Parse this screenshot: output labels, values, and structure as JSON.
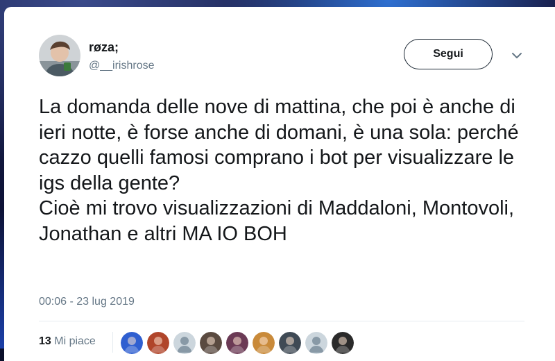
{
  "user": {
    "display_name": "røza;",
    "handle": "@__irishrose"
  },
  "follow_button": {
    "label": "Segui"
  },
  "menu": {
    "icon": "chevron-down-icon"
  },
  "tweet": {
    "text": "La domanda delle nove di mattina, che poi è anche di ieri notte, è forse anche di domani, è una sola: perché cazzo quelli famosi comprano i bot per visualizzare le igs della gente?\nCioè mi trovo visualizzazioni di Maddaloni, Montovoli, Jonathan e altri MA IO BOH",
    "timestamp": "00:06 - 23 lug 2019"
  },
  "stats": {
    "likes_count": "13",
    "likes_label": "Mi piace"
  },
  "likers": [
    {
      "icon": "liker-avatar",
      "color": "#2f5fd0"
    },
    {
      "icon": "liker-avatar",
      "color": "#b0452a"
    },
    {
      "icon": "default-profile-icon",
      "color": "#ccd6dd"
    },
    {
      "icon": "liker-avatar",
      "color": "#5a4a40"
    },
    {
      "icon": "liker-avatar",
      "color": "#6b3a55"
    },
    {
      "icon": "liker-avatar",
      "color": "#c98a3a"
    },
    {
      "icon": "liker-avatar",
      "color": "#3f4a55"
    },
    {
      "icon": "default-profile-icon",
      "color": "#ccd6dd"
    },
    {
      "icon": "liker-avatar",
      "color": "#2a2a2a"
    }
  ],
  "colors": {
    "text_primary": "#14171a",
    "text_secondary": "#657786",
    "divider": "#e6ecf0"
  }
}
